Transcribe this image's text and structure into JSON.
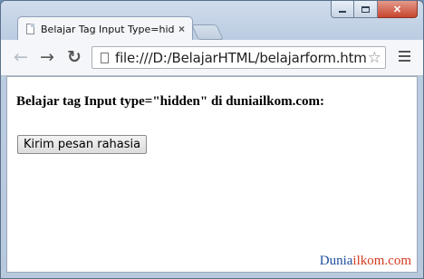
{
  "browser": {
    "tab_title": "Belajar Tag Input Type=hidden",
    "tab_close": "×",
    "url": "file:///D:/BelajarHTML/belajarform.html"
  },
  "icons": {
    "back": "←",
    "forward": "→",
    "reload": "↻",
    "star": "☆",
    "window_close": "✕"
  },
  "page": {
    "heading": "Belajar tag Input type=\"hidden\" di duniailkom.com:",
    "submit_label": "Kirim pesan rahasia"
  },
  "watermark": {
    "part1": "Dunia",
    "part2": "ilkom.com"
  },
  "colors": {
    "watermark_blue": "#1e4e9a",
    "watermark_red": "#d33a1f",
    "close_button": "#c7462f"
  }
}
